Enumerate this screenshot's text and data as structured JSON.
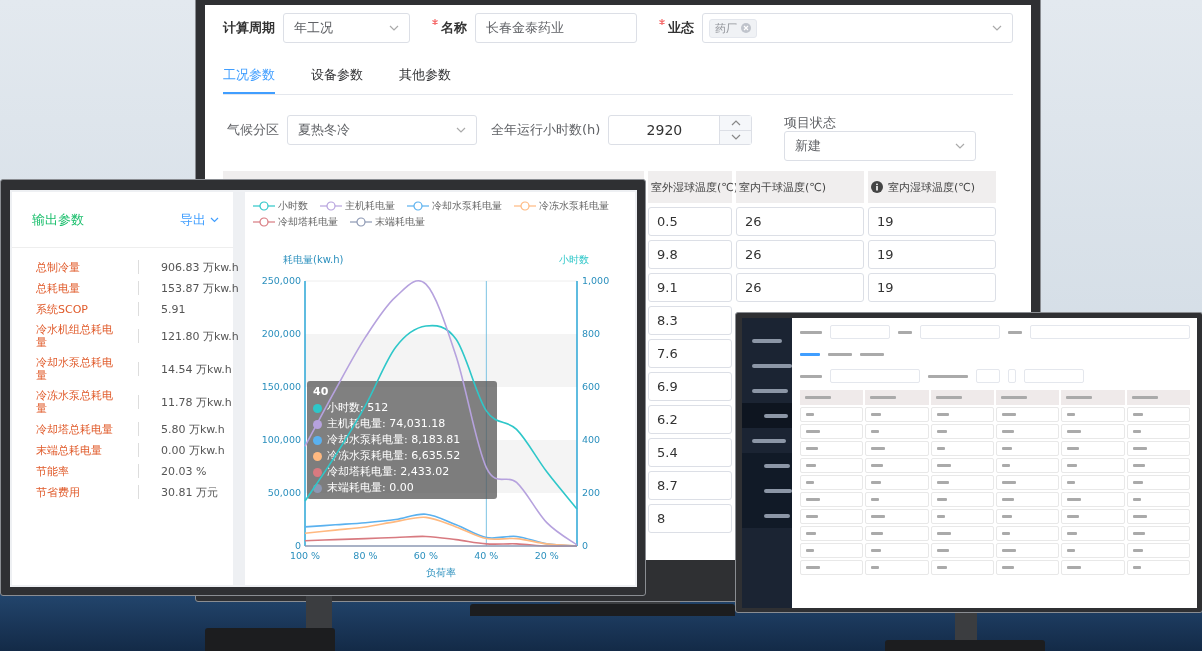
{
  "back_screen": {
    "form": [
      {
        "label": "计算周期",
        "required": false,
        "kind": "select",
        "value": "年工况"
      },
      {
        "label": "名称",
        "required": true,
        "kind": "input",
        "value": "长春金泰药业"
      },
      {
        "label": "业态",
        "required": true,
        "kind": "tags",
        "tags": [
          "药厂"
        ]
      }
    ],
    "tabs": [
      {
        "label": "工况参数",
        "selected": true
      },
      {
        "label": "设备参数",
        "selected": false
      },
      {
        "label": "其他参数",
        "selected": false
      }
    ],
    "params": [
      {
        "label": "气候分区",
        "kind": "select",
        "value": "夏热冬冷"
      },
      {
        "label": "全年运行小时数(h)",
        "kind": "number",
        "value": "2920"
      },
      {
        "label": "项目状态",
        "kind": "select-stacked",
        "value": "新建"
      }
    ],
    "table": {
      "columns": [
        {
          "label": "室外湿球温度(℃)",
          "info": false
        },
        {
          "label": "室内干球温度(℃)",
          "info": false
        },
        {
          "label": "室内湿球温度(℃)",
          "info": true
        }
      ],
      "rows": [
        [
          "0.5",
          "26",
          "19"
        ],
        [
          "9.8",
          "26",
          "19"
        ],
        [
          "9.1",
          "26",
          "19"
        ],
        [
          "8.3"
        ],
        [
          "7.6"
        ],
        [
          "6.9"
        ],
        [
          "6.2"
        ],
        [
          "5.4"
        ],
        [
          "8.7"
        ],
        [
          "8"
        ]
      ]
    }
  },
  "left_screen": {
    "output_panel": {
      "title": "输出参数",
      "export_button": "导出",
      "items": [
        {
          "label": "总制冷量",
          "value": "906.83 万kw.h"
        },
        {
          "label": "总耗电量",
          "value": "153.87 万kw.h"
        },
        {
          "label": "系统SCOP",
          "value": "5.91"
        },
        {
          "label": "冷水机组总耗电量",
          "value": "121.80 万kw.h"
        },
        {
          "label": "冷却水泵总耗电量",
          "value": "14.54 万kw.h"
        },
        {
          "label": "冷冻水泵总耗电量",
          "value": "11.78 万kw.h"
        },
        {
          "label": "冷却塔总耗电量",
          "value": "5.80 万kw.h"
        },
        {
          "label": "末端总耗电量",
          "value": "0.00 万kw.h"
        },
        {
          "label": "节能率",
          "value": "20.03 %"
        },
        {
          "label": "节省费用",
          "value": "30.81 万元"
        }
      ]
    },
    "chart": {
      "chart_data": {
        "type": "line",
        "xlabel": "负荷率",
        "ylabel": "耗电量(kw.h)",
        "y2label": "小时数",
        "x": [
          100,
          90,
          80,
          70,
          60,
          50,
          40,
          30,
          20,
          10
        ],
        "xlim": [
          100,
          10
        ],
        "xticks": [
          {
            "value": 100,
            "label": "100 %"
          },
          {
            "value": 80,
            "label": "80 %"
          },
          {
            "value": 60,
            "label": "60 %"
          },
          {
            "value": 40,
            "label": "40 %"
          },
          {
            "value": 20,
            "label": "20 %"
          }
        ],
        "ylim": [
          0,
          250000
        ],
        "yticks": [
          {
            "value": 0,
            "label": "0"
          },
          {
            "value": 50000,
            "label": "50,000"
          },
          {
            "value": 100000,
            "label": "100,000"
          },
          {
            "value": 150000,
            "label": "150,000"
          },
          {
            "value": 200000,
            "label": "200,000"
          },
          {
            "value": 250000,
            "label": "250,000"
          }
        ],
        "y2lim": [
          0,
          1000
        ],
        "y2ticks": [
          {
            "value": 0,
            "label": "0"
          },
          {
            "value": 200,
            "label": "200"
          },
          {
            "value": 400,
            "label": "400"
          },
          {
            "value": 600,
            "label": "600"
          },
          {
            "value": 800,
            "label": "800"
          },
          {
            "value": 1000,
            "label": "1,000"
          }
        ],
        "series": [
          {
            "name": "小时数",
            "color": "#2ec7c9",
            "axis": "y2",
            "values": [
              170,
              340,
              530,
              750,
              830,
              780,
              510,
              440,
              280,
              140
            ]
          },
          {
            "name": "主机耗电量",
            "color": "#b6a2de",
            "values": [
              94000,
              147000,
              197000,
              235000,
              247000,
              179000,
              74000,
              60000,
              22000,
              1000
            ]
          },
          {
            "name": "冷却水泵耗电量",
            "color": "#5ab1ef",
            "values": [
              18000,
              20000,
              22000,
              25000,
              30000,
              20000,
              8000,
              9000,
              2000,
              0
            ]
          },
          {
            "name": "冷冻水泵耗电量",
            "color": "#ffb980",
            "values": [
              12000,
              15000,
              18000,
              23000,
              27000,
              18000,
              7000,
              7000,
              2000,
              0
            ]
          },
          {
            "name": "冷却塔耗电量",
            "color": "#d87a80",
            "values": [
              5000,
              6000,
              7000,
              8000,
              9000,
              6000,
              2000,
              2000,
              0,
              0
            ]
          },
          {
            "name": "末端耗电量",
            "color": "#8d98b3",
            "values": [
              0,
              0,
              0,
              0,
              0,
              0,
              0,
              0,
              0,
              0
            ]
          }
        ],
        "ref_lines": [
          {
            "axis": "x",
            "value": 40
          }
        ]
      },
      "tooltip": {
        "title": "40",
        "items": [
          {
            "text": "小时数: 512",
            "color": "#2ec7c9"
          },
          {
            "text": "主机耗电量: 74,031.18",
            "color": "#b6a2de"
          },
          {
            "text": "冷却水泵耗电量: 8,183.81",
            "color": "#5ab1ef"
          },
          {
            "text": "冷冻水泵耗电量: 6,635.52",
            "color": "#ffb980"
          },
          {
            "text": "冷却塔耗电量: 2,433.02",
            "color": "#d87a80"
          },
          {
            "text": "末端耗电量: 0.00",
            "color": "#8d98b3"
          }
        ]
      }
    }
  }
}
